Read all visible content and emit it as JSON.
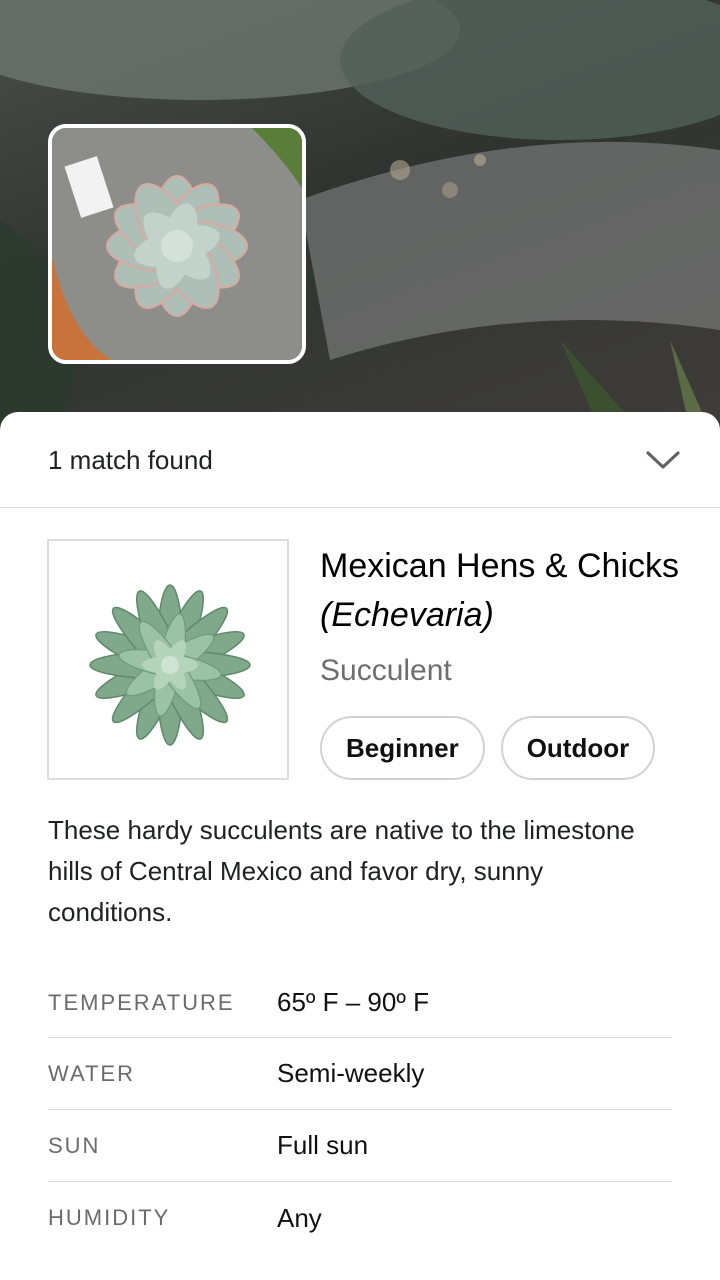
{
  "results": {
    "match_count": "1 match found"
  },
  "plant": {
    "common_name": "Mexican Hens & Chicks",
    "latin_name": "(Echevaria)",
    "type": "Succulent",
    "tags": [
      "Beginner",
      "Outdoor"
    ],
    "description": "These hardy succulents are native to the limestone hills of Central Mexico and favor dry, sunny conditions."
  },
  "care": [
    {
      "label": "TEMPERATURE",
      "value": "65º F – 90º F"
    },
    {
      "label": "WATER",
      "value": "Semi-weekly"
    },
    {
      "label": "SUN",
      "value": "Full sun"
    },
    {
      "label": "HUMIDITY",
      "value": "Any"
    }
  ],
  "icons": {
    "collapse": "chevron-down-icon"
  },
  "colors": {
    "sheet": "#ffffff",
    "text_primary": "#202124",
    "text_secondary": "#6e6e6e",
    "divider": "#dcdcdc"
  }
}
